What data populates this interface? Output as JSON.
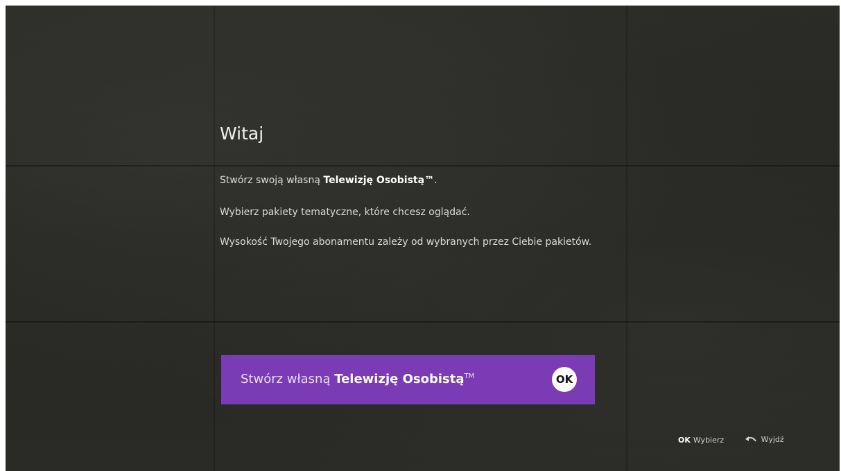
{
  "welcome": {
    "title": "Witaj",
    "line1_prefix": "Stwórz swoją własną ",
    "line1_bold": "Telewizję Osobistą™",
    "line1_suffix": ".",
    "line2": "Wybierz pakiety tematyczne, które chcesz oglądać.",
    "line3": "Wysokość Twojego abonamentu zależy od wybranych przez Ciebie pakietów."
  },
  "cta": {
    "text_prefix": "Stwórz własną ",
    "text_bold": "Telewizję Osobistą",
    "text_tm": "TM",
    "ok_label": "OK",
    "color": "#7b3bb5"
  },
  "hints": {
    "ok_key": "OK",
    "ok_label": "Wybierz",
    "back_icon": "back-arrow-icon",
    "back_label": "Wyjdź"
  }
}
